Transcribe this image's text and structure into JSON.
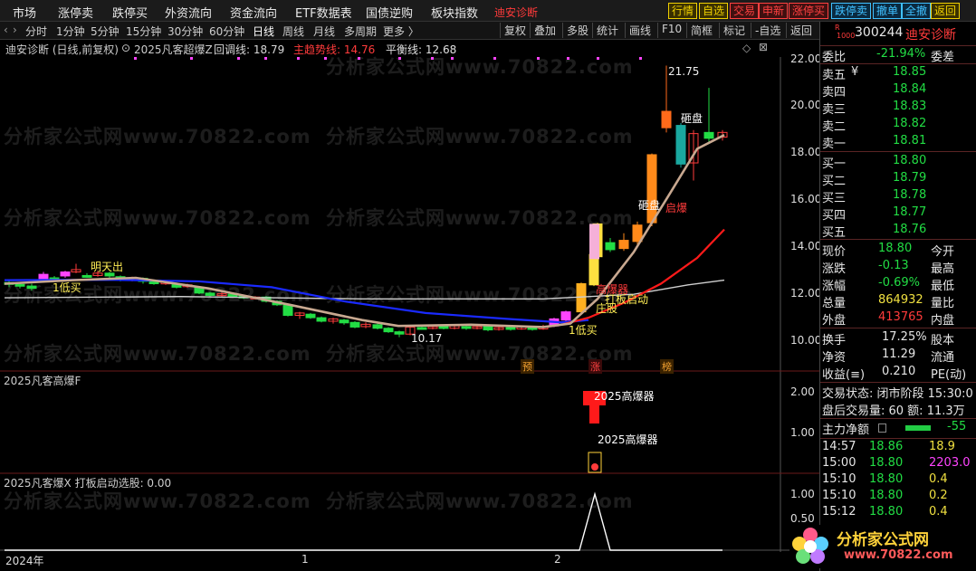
{
  "menu": {
    "items": [
      "市场",
      "涨停卖",
      "跌停买",
      "外资流向",
      "资金流向",
      "ETF数据表",
      "国债逆购",
      "板块指数"
    ],
    "stock_tag": "迪安诊断",
    "buttons": [
      {
        "label": "行情",
        "color": "#f0d000",
        "bg": "#3a3000"
      },
      {
        "label": "自选",
        "color": "#f0d000",
        "bg": "#3a3000"
      },
      {
        "label": "交易",
        "color": "#ff4040",
        "bg": "#401010"
      },
      {
        "label": "申新",
        "color": "#ff4040",
        "bg": "#401010"
      },
      {
        "label": "涨停买",
        "color": "#ff4040",
        "bg": "#401010"
      },
      {
        "label": "跌停卖",
        "color": "#40c0ff",
        "bg": "#0a2a40"
      },
      {
        "label": "撤单",
        "color": "#40c0ff",
        "bg": "#0a2a40"
      },
      {
        "label": "全撤",
        "color": "#40c0ff",
        "bg": "#0a2a40"
      },
      {
        "label": "返回",
        "color": "#f0d000",
        "bg": "#3a3000"
      }
    ]
  },
  "periods": [
    "分时",
    "1分钟",
    "5分钟",
    "15分钟",
    "30分钟",
    "60分钟",
    "日线",
    "周线",
    "月线",
    "多周期",
    "更多 〉"
  ],
  "active_period": "日线",
  "tools": [
    "复权",
    "叠加",
    "多股",
    "统计",
    "画线",
    "F10",
    "简框",
    "标记",
    "-自选",
    "返回"
  ],
  "main_title": {
    "name": "迪安诊断 (日线,前复权)",
    "indicator": "2025凡客超爆Z",
    "huitiao": "回调线: 18.79",
    "qushi": "主趋势线: 14.76",
    "pingheng": "平衡线: 12.68"
  },
  "panel2_title": "2025凡客高爆F",
  "panel3_title": "2025凡客爆X  打板启动选股: 0.00",
  "watermark": "分析家公式网www.70822.com",
  "chart_data": {
    "type": "candlestick",
    "y_axis": [
      "22.00",
      "20.00",
      "18.00",
      "16.00",
      "14.00",
      "12.00",
      "10.00"
    ],
    "panel2_axis": [
      "2.00",
      "1.00"
    ],
    "panel3_axis": [
      "1.00",
      "0.50"
    ],
    "x_labels": [
      "2024年",
      "1",
      "2"
    ],
    "high_label": "21.75",
    "low_label": "10.17",
    "annotations": [
      "明天出",
      "1低买",
      "打板启动",
      "庄股",
      "1低买",
      "砸盘",
      "砸盘",
      "启爆",
      "高爆器"
    ],
    "signal_tags": [
      "预",
      "涨",
      "榜"
    ],
    "panel2_labels": [
      "2025高爆器",
      "2025高爆器"
    ],
    "ma_colors": {
      "blue": "#1a2aff",
      "red": "#ff1a1a",
      "white": "#cfcfcf",
      "tan": "#c8a890"
    }
  },
  "quote": {
    "code": "300244",
    "name": "迪安诊断",
    "weibi_label": "委比",
    "weibi": "-21.94%",
    "weicha_label": "委差",
    "asks": [
      {
        "label": "卖五",
        "price": "18.85",
        "flag": "¥"
      },
      {
        "label": "卖四",
        "price": "18.84",
        "flag": ""
      },
      {
        "label": "卖三",
        "price": "18.83",
        "flag": ""
      },
      {
        "label": "卖二",
        "price": "18.82",
        "flag": ""
      },
      {
        "label": "卖一",
        "price": "18.81",
        "flag": ""
      }
    ],
    "bids": [
      {
        "label": "买一",
        "price": "18.80"
      },
      {
        "label": "买二",
        "price": "18.79"
      },
      {
        "label": "买三",
        "price": "18.78"
      },
      {
        "label": "买四",
        "price": "18.77"
      },
      {
        "label": "买五",
        "price": "18.76"
      }
    ],
    "stats": [
      {
        "l1": "现价",
        "v1": "18.80",
        "c1": "green",
        "l2": "今开"
      },
      {
        "l1": "涨跌",
        "v1": "-0.13",
        "c1": "green",
        "l2": "最高"
      },
      {
        "l1": "涨幅",
        "v1": "-0.69%",
        "c1": "green",
        "l2": "最低"
      },
      {
        "l1": "总量",
        "v1": "864932",
        "c1": "yellow",
        "l2": "量比"
      },
      {
        "l1": "外盘",
        "v1": "413765",
        "c1": "red",
        "l2": "内盘"
      }
    ],
    "stats2": [
      {
        "l1": "换手",
        "v1": "17.25%",
        "l2": "股本"
      },
      {
        "l1": "净资",
        "v1": "11.29",
        "l2": "流通"
      },
      {
        "l1": "收益(≡)",
        "v1": "0.210",
        "l2": "PE(动)"
      }
    ],
    "trade_status": "交易状态: 闭市阶段 15:30:0",
    "after_hours": "盘后交易量: 60  额: 11.3万",
    "main_flow_label": "主力净额",
    "main_flow_value": "-55",
    "ticks": [
      {
        "time": "14:57",
        "price": "18.86",
        "vol": "18.9",
        "vc": "yellow"
      },
      {
        "time": "15:00",
        "price": "18.80",
        "vol": "2203.0",
        "vc": "magenta"
      },
      {
        "time": "15:10",
        "price": "18.80",
        "vol": "0.4",
        "vc": "yellow"
      },
      {
        "time": "15:10",
        "price": "18.80",
        "vol": "0.2",
        "vc": "yellow"
      },
      {
        "time": "15:12",
        "price": "18.80",
        "vol": "0.4",
        "vc": "yellow"
      }
    ]
  },
  "logo": {
    "title": "分析家公式网",
    "url": "www.70822.com"
  }
}
